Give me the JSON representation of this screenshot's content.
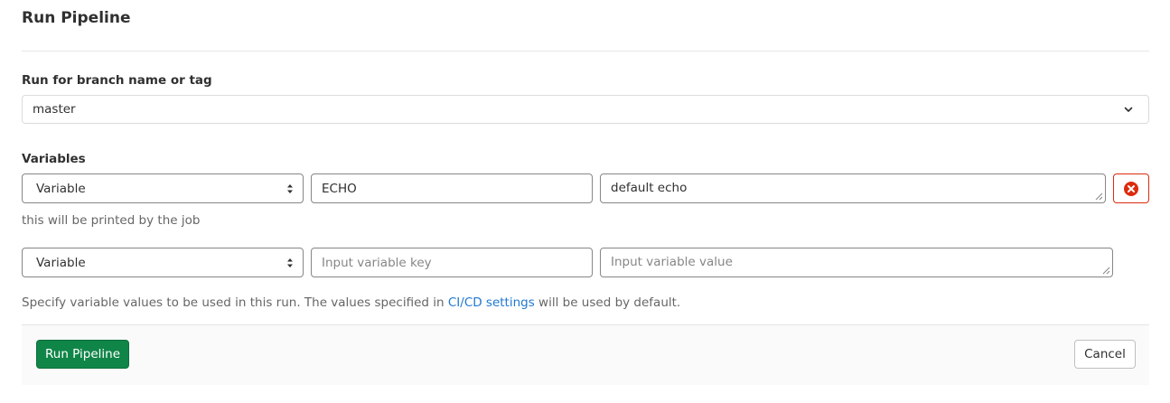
{
  "page_title": "Run Pipeline",
  "branch": {
    "label": "Run for branch name or tag",
    "selected": "master",
    "icon": "chevron-down-icon"
  },
  "variables": {
    "label": "Variables",
    "rows": [
      {
        "type": "Variable",
        "key": "ECHO",
        "value": "default echo",
        "description": "this will be printed by the job",
        "remove_icon": "remove-circle-icon"
      },
      {
        "type": "Variable",
        "key_placeholder": "Input variable key",
        "value_placeholder": "Input variable value"
      }
    ]
  },
  "help": {
    "prefix": "Specify variable values to be used in this run. The values specified in ",
    "link_text": "CI/CD settings",
    "suffix": " will be used by default."
  },
  "actions": {
    "run_label": "Run Pipeline",
    "cancel_label": "Cancel"
  },
  "colors": {
    "primary_green": "#108548",
    "danger_red": "#dd2b0e",
    "link_blue": "#1f78d1"
  }
}
